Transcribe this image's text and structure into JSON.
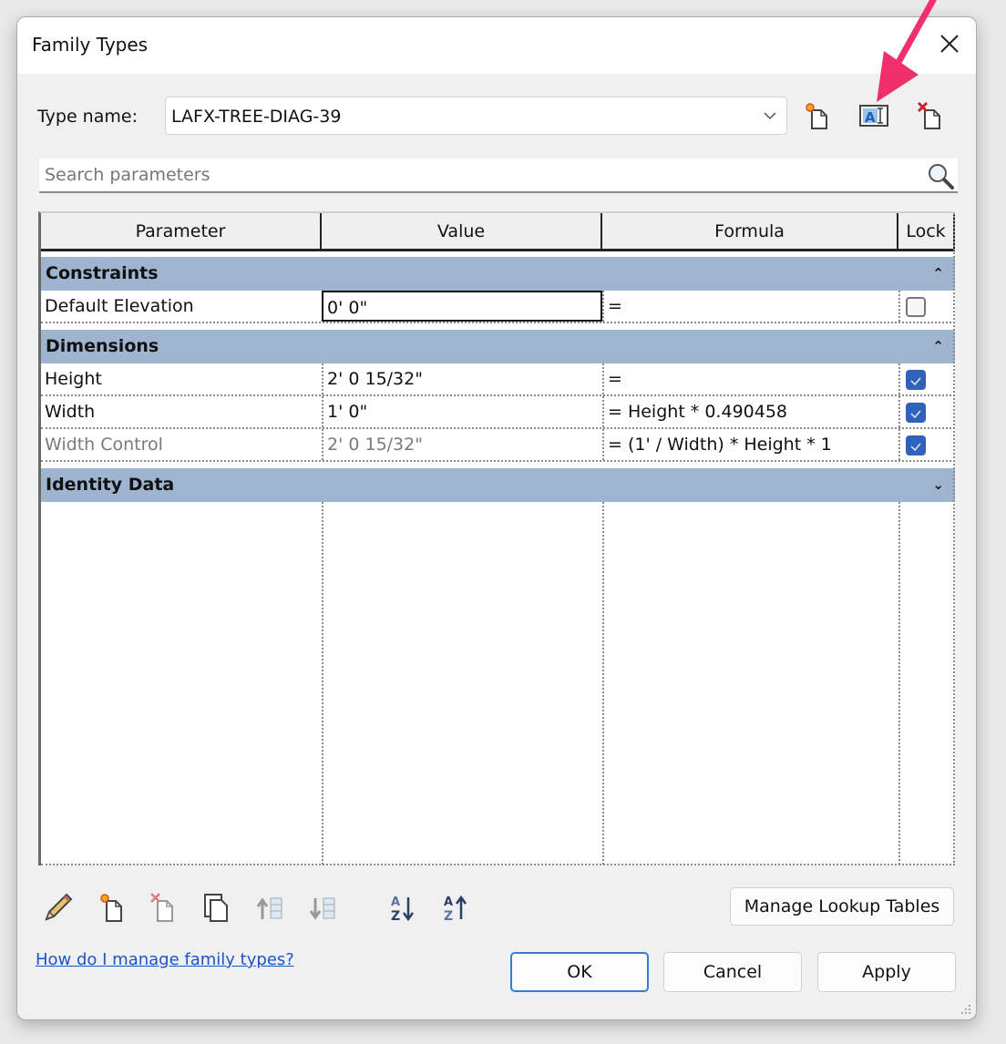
{
  "dialog": {
    "title": "Family Types",
    "type_name_label": "Type name:",
    "type_name_value": "LAFX-TREE-DIAG-39",
    "search_placeholder": "Search parameters"
  },
  "columns": [
    "Parameter",
    "Value",
    "Formula",
    "Lock"
  ],
  "groups": [
    {
      "name": "Constraints",
      "state": "expanded",
      "rows": [
        {
          "parameter": "Default Elevation",
          "value": "0'  0\"",
          "formula": "=",
          "locked": false,
          "grayed": false,
          "active": true
        }
      ]
    },
    {
      "name": "Dimensions",
      "state": "expanded",
      "rows": [
        {
          "parameter": "Height",
          "value": "2'  0 15/32\"",
          "formula": "=",
          "locked": true,
          "grayed": false
        },
        {
          "parameter": "Width",
          "value": "1'  0\"",
          "formula": "= Height * 0.490458",
          "locked": true,
          "grayed": false
        },
        {
          "parameter": "Width Control",
          "value": "2'  0 15/32\"",
          "formula": "= (1' / Width) * Height * 1",
          "locked": true,
          "grayed": true
        }
      ]
    },
    {
      "name": "Identity Data",
      "state": "collapsed",
      "rows": []
    }
  ],
  "toggle_glyphs": {
    "expanded": "⌃",
    "collapsed": "⌄"
  },
  "toolbar_icons": [
    "new-type-icon",
    "rename-type-icon",
    "delete-type-icon"
  ],
  "bottom_icons": [
    "edit-parameter-icon",
    "new-parameter-icon",
    "delete-parameter-icon",
    "duplicate-parameter-icon",
    "move-up-icon",
    "move-down-icon",
    "sort-ascending-icon",
    "sort-descending-icon"
  ],
  "buttons": {
    "manage_lookup": "Manage Lookup Tables",
    "ok": "OK",
    "cancel": "Cancel",
    "apply": "Apply"
  },
  "help_link": "How do I manage family types?",
  "colors": {
    "section_header": "#9fb4ce",
    "checkbox_on": "#2f62b8",
    "annotation_arrow": "#f0306a",
    "link": "#1a56c8"
  }
}
